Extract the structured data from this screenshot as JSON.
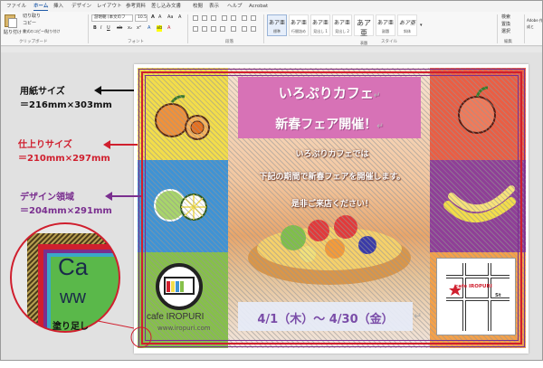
{
  "ribbon": {
    "tabs": [
      "ファイル",
      "ホーム",
      "挿入",
      "デザイン",
      "レイアウト",
      "参考資料",
      "差し込み文書",
      "校閲",
      "表示",
      "ヘルプ",
      "Acrobat"
    ],
    "active_tab": "ホーム",
    "paste_label": "貼り付け",
    "clipboard_items": [
      "切り取り",
      "コピー",
      "書式のコピー/貼り付け"
    ],
    "font_name": "游明朝 (本文のフ",
    "font_size": "10.5",
    "groups": [
      "クリップボード",
      "フォント",
      "段落",
      "スタイル",
      "編集"
    ],
    "styles": [
      {
        "sample": "あア亜",
        "name": "標準"
      },
      {
        "sample": "あア亜",
        "name": "行間詰め"
      },
      {
        "sample": "あア亜",
        "name": "見出し 1"
      },
      {
        "sample": "あア亜",
        "name": "見出し 2"
      },
      {
        "sample": "あア亜",
        "name": "表題"
      },
      {
        "sample": "あア亜",
        "name": "副題"
      },
      {
        "sample": "あア亜",
        "name": "斜体"
      }
    ],
    "edit_items": [
      "検索",
      "置換",
      "選択"
    ],
    "acrobat_label": "Adobe 作成と"
  },
  "annotations": [
    {
      "line1": "用紙サイズ",
      "line2": "＝216mm×303mm",
      "color": "#111111"
    },
    {
      "line1": "仕上りサイズ",
      "line2": "＝210mm×297mm",
      "color": "#d01f2e"
    },
    {
      "line1": "デザイン領域",
      "line2": "＝204mm×291mm",
      "color": "#7a2f8f"
    }
  ],
  "zoom_label": "塗り足し",
  "zoom_text": "Ca",
  "zoom_text2": "ww",
  "flyer": {
    "banner_line1": "いろぷりカフェ",
    "banner_line2": "新春フェア開催！",
    "intro_lines": [
      "いろぷりカフェでは",
      "下記の期間で新春フェアを開催します。",
      "是非ご来店ください！"
    ],
    "date": "4/1（木）～ 4/30（金）",
    "cafe_name": "cafe IROPURI",
    "cafe_url": "www.iropuri.com",
    "map_label": "cafe IROPURI",
    "map_street": "St",
    "para_mark": "↵",
    "colors": {
      "yellow": "#f3dd4a",
      "blue": "#3f93d5",
      "green": "#86c04a",
      "pink": "#d772b6",
      "red_orange": "#ea5e44",
      "orange": "#f4a14a",
      "purple": "#8f3f97",
      "date_text": "#7a4da8"
    }
  }
}
